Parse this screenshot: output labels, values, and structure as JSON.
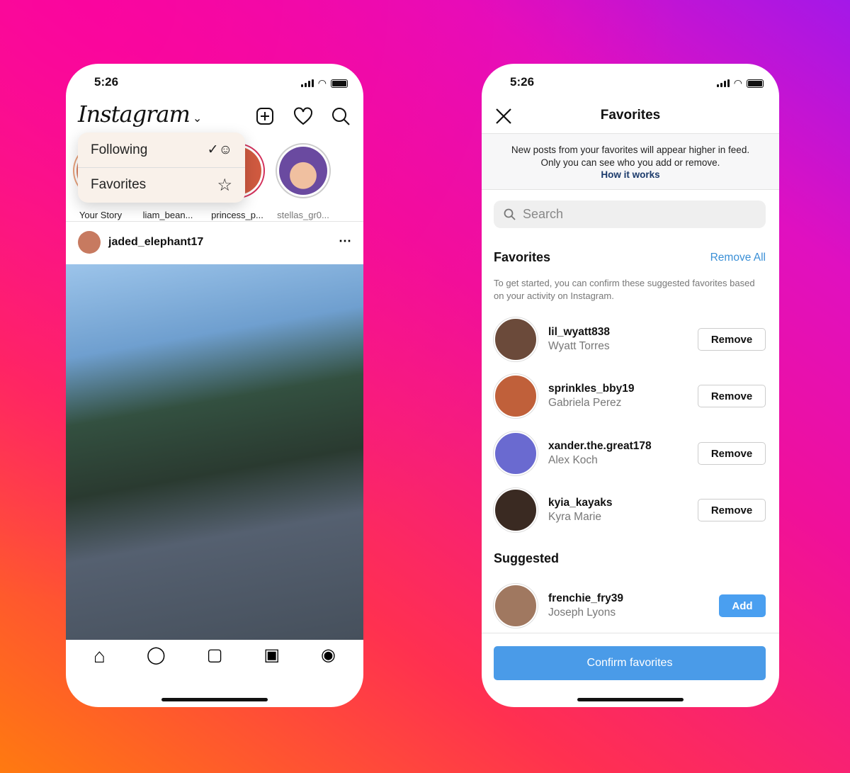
{
  "left_phone": {
    "status_time": "5:26",
    "logo": "Instagram",
    "header_icons": [
      "new-post-icon",
      "heart-icon",
      "search-icon"
    ],
    "feed_menu": [
      {
        "label": "Following",
        "icon": "following-icon"
      },
      {
        "label": "Favorites",
        "icon": "star-icon"
      }
    ],
    "stories": [
      {
        "label": "Your Story"
      },
      {
        "label": "liam_bean..."
      },
      {
        "label": "princess_p..."
      },
      {
        "label": "stellas_gr0..."
      }
    ],
    "post": {
      "username": "jaded_elephant17",
      "more_icon": "more-icon"
    },
    "tab_bar": [
      "home-icon",
      "messenger-icon",
      "reels-icon",
      "shop-icon",
      "profile-icon"
    ]
  },
  "right_phone": {
    "status_time": "5:26",
    "title": "Favorites",
    "info": {
      "line1": "New posts from your favorites will appear higher in feed.",
      "line2": "Only you can see who you add or remove.",
      "link": "How it works"
    },
    "search_placeholder": "Search",
    "favorites_heading": "Favorites",
    "remove_all": "Remove All",
    "help_text": "To get started, you can confirm these suggested favorites based on your activity on Instagram.",
    "favorites": [
      {
        "username": "lil_wyatt838",
        "name": "Wyatt Torres",
        "action": "Remove"
      },
      {
        "username": "sprinkles_bby19",
        "name": "Gabriela Perez",
        "action": "Remove"
      },
      {
        "username": "xander.the.great178",
        "name": "Alex Koch",
        "action": "Remove"
      },
      {
        "username": "kyia_kayaks",
        "name": "Kyra Marie",
        "action": "Remove"
      }
    ],
    "suggested_heading": "Suggested",
    "suggested": [
      {
        "username": "frenchie_fry39",
        "name": "Joseph Lyons",
        "action": "Add"
      }
    ],
    "confirm": "Confirm favorites",
    "accent": "#4a9be8"
  }
}
